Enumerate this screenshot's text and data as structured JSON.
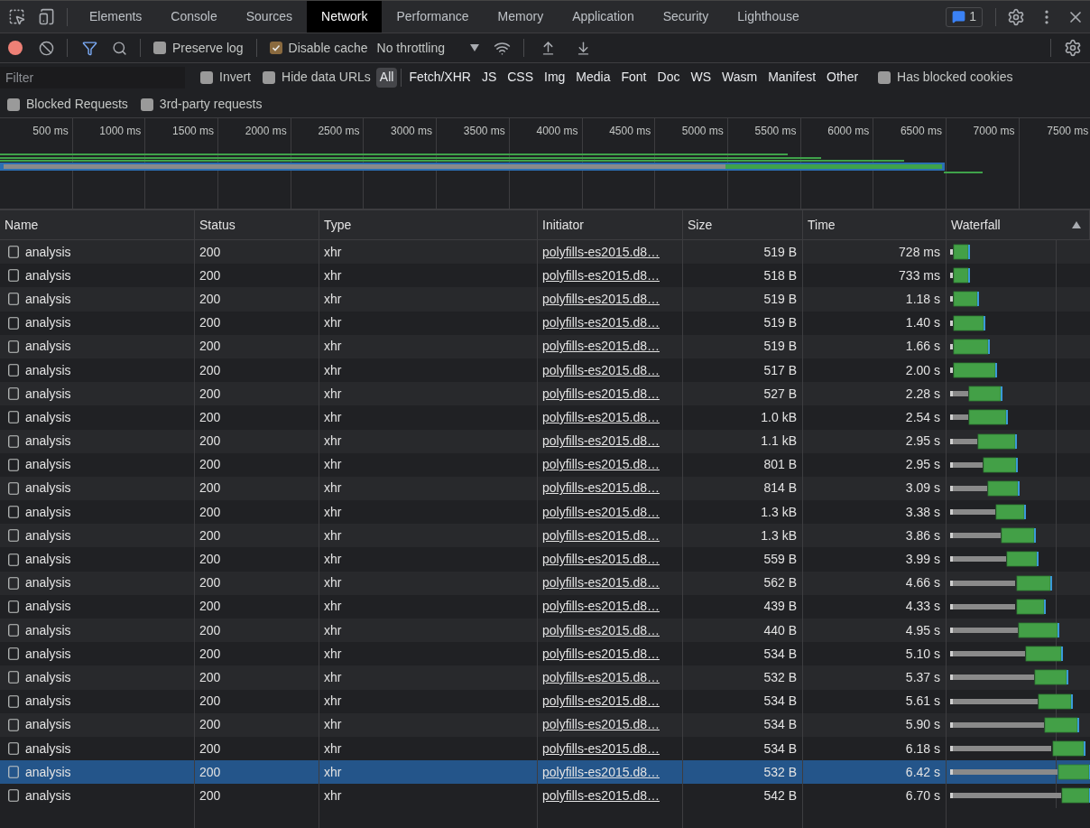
{
  "tabs": [
    {
      "label": "Elements",
      "selected": false
    },
    {
      "label": "Console",
      "selected": false
    },
    {
      "label": "Sources",
      "selected": false
    },
    {
      "label": "Network",
      "selected": true
    },
    {
      "label": "Performance",
      "selected": false
    },
    {
      "label": "Memory",
      "selected": false
    },
    {
      "label": "Application",
      "selected": false
    },
    {
      "label": "Security",
      "selected": false
    },
    {
      "label": "Lighthouse",
      "selected": false
    }
  ],
  "issues_badge": "1",
  "toolbar": {
    "recording": true,
    "preserve_log": {
      "label": "Preserve log",
      "checked": false
    },
    "disable_cache": {
      "label": "Disable cache",
      "checked": true
    },
    "throttling": "No throttling"
  },
  "filter": {
    "placeholder": "Filter",
    "invert": {
      "label": "Invert",
      "checked": false
    },
    "hide_data_urls": {
      "label": "Hide data URLs",
      "checked": false
    },
    "types": [
      {
        "label": "All",
        "selected": true
      },
      {
        "label": "Fetch/XHR",
        "selected": false
      },
      {
        "label": "JS",
        "selected": false
      },
      {
        "label": "CSS",
        "selected": false
      },
      {
        "label": "Img",
        "selected": false
      },
      {
        "label": "Media",
        "selected": false
      },
      {
        "label": "Font",
        "selected": false
      },
      {
        "label": "Doc",
        "selected": false
      },
      {
        "label": "WS",
        "selected": false
      },
      {
        "label": "Wasm",
        "selected": false
      },
      {
        "label": "Manifest",
        "selected": false
      },
      {
        "label": "Other",
        "selected": false
      }
    ],
    "has_blocked_cookies": {
      "label": "Has blocked cookies",
      "checked": false
    },
    "blocked_requests": {
      "label": "Blocked Requests",
      "checked": false
    },
    "third_party": {
      "label": "3rd-party requests",
      "checked": false
    }
  },
  "overview_ticks": [
    "500 ms",
    "1000 ms",
    "1500 ms",
    "2000 ms",
    "2500 ms",
    "3000 ms",
    "3500 ms",
    "4000 ms",
    "4500 ms",
    "5000 ms",
    "5500 ms",
    "6000 ms",
    "6500 ms",
    "7000 ms",
    "7500 ms"
  ],
  "columns": [
    {
      "label": "Name"
    },
    {
      "label": "Status"
    },
    {
      "label": "Type"
    },
    {
      "label": "Initiator"
    },
    {
      "label": "Size"
    },
    {
      "label": "Time"
    },
    {
      "label": "Waterfall",
      "sorted": true
    }
  ],
  "rows": [
    {
      "name": "analysis",
      "status": "200",
      "type": "xhr",
      "initiator": "polyfills-es2015.d8…",
      "size": "519 B",
      "time": "728 ms",
      "selected": false
    },
    {
      "name": "analysis",
      "status": "200",
      "type": "xhr",
      "initiator": "polyfills-es2015.d8…",
      "size": "518 B",
      "time": "733 ms",
      "selected": false
    },
    {
      "name": "analysis",
      "status": "200",
      "type": "xhr",
      "initiator": "polyfills-es2015.d8…",
      "size": "519 B",
      "time": "1.18 s",
      "selected": false
    },
    {
      "name": "analysis",
      "status": "200",
      "type": "xhr",
      "initiator": "polyfills-es2015.d8…",
      "size": "519 B",
      "time": "1.40 s",
      "selected": false
    },
    {
      "name": "analysis",
      "status": "200",
      "type": "xhr",
      "initiator": "polyfills-es2015.d8…",
      "size": "519 B",
      "time": "1.66 s",
      "selected": false
    },
    {
      "name": "analysis",
      "status": "200",
      "type": "xhr",
      "initiator": "polyfills-es2015.d8…",
      "size": "517 B",
      "time": "2.00 s",
      "selected": false
    },
    {
      "name": "analysis",
      "status": "200",
      "type": "xhr",
      "initiator": "polyfills-es2015.d8…",
      "size": "527 B",
      "time": "2.28 s",
      "selected": false
    },
    {
      "name": "analysis",
      "status": "200",
      "type": "xhr",
      "initiator": "polyfills-es2015.d8…",
      "size": "1.0 kB",
      "time": "2.54 s",
      "selected": false
    },
    {
      "name": "analysis",
      "status": "200",
      "type": "xhr",
      "initiator": "polyfills-es2015.d8…",
      "size": "1.1 kB",
      "time": "2.95 s",
      "selected": false
    },
    {
      "name": "analysis",
      "status": "200",
      "type": "xhr",
      "initiator": "polyfills-es2015.d8…",
      "size": "801 B",
      "time": "2.95 s",
      "selected": false
    },
    {
      "name": "analysis",
      "status": "200",
      "type": "xhr",
      "initiator": "polyfills-es2015.d8…",
      "size": "814 B",
      "time": "3.09 s",
      "selected": false
    },
    {
      "name": "analysis",
      "status": "200",
      "type": "xhr",
      "initiator": "polyfills-es2015.d8…",
      "size": "1.3 kB",
      "time": "3.38 s",
      "selected": false
    },
    {
      "name": "analysis",
      "status": "200",
      "type": "xhr",
      "initiator": "polyfills-es2015.d8…",
      "size": "1.3 kB",
      "time": "3.86 s",
      "selected": false
    },
    {
      "name": "analysis",
      "status": "200",
      "type": "xhr",
      "initiator": "polyfills-es2015.d8…",
      "size": "559 B",
      "time": "3.99 s",
      "selected": false
    },
    {
      "name": "analysis",
      "status": "200",
      "type": "xhr",
      "initiator": "polyfills-es2015.d8…",
      "size": "562 B",
      "time": "4.66 s",
      "selected": false
    },
    {
      "name": "analysis",
      "status": "200",
      "type": "xhr",
      "initiator": "polyfills-es2015.d8…",
      "size": "439 B",
      "time": "4.33 s",
      "selected": false
    },
    {
      "name": "analysis",
      "status": "200",
      "type": "xhr",
      "initiator": "polyfills-es2015.d8…",
      "size": "440 B",
      "time": "4.95 s",
      "selected": false
    },
    {
      "name": "analysis",
      "status": "200",
      "type": "xhr",
      "initiator": "polyfills-es2015.d8…",
      "size": "534 B",
      "time": "5.10 s",
      "selected": false
    },
    {
      "name": "analysis",
      "status": "200",
      "type": "xhr",
      "initiator": "polyfills-es2015.d8…",
      "size": "532 B",
      "time": "5.37 s",
      "selected": false
    },
    {
      "name": "analysis",
      "status": "200",
      "type": "xhr",
      "initiator": "polyfills-es2015.d8…",
      "size": "534 B",
      "time": "5.61 s",
      "selected": false
    },
    {
      "name": "analysis",
      "status": "200",
      "type": "xhr",
      "initiator": "polyfills-es2015.d8…",
      "size": "534 B",
      "time": "5.90 s",
      "selected": false
    },
    {
      "name": "analysis",
      "status": "200",
      "type": "xhr",
      "initiator": "polyfills-es2015.d8…",
      "size": "534 B",
      "time": "6.18 s",
      "selected": false
    },
    {
      "name": "analysis",
      "status": "200",
      "type": "xhr",
      "initiator": "polyfills-es2015.d8…",
      "size": "532 B",
      "time": "6.42 s",
      "selected": true
    },
    {
      "name": "analysis",
      "status": "200",
      "type": "xhr",
      "initiator": "polyfills-es2015.d8…",
      "size": "542 B",
      "time": "6.70 s",
      "selected": false
    }
  ]
}
